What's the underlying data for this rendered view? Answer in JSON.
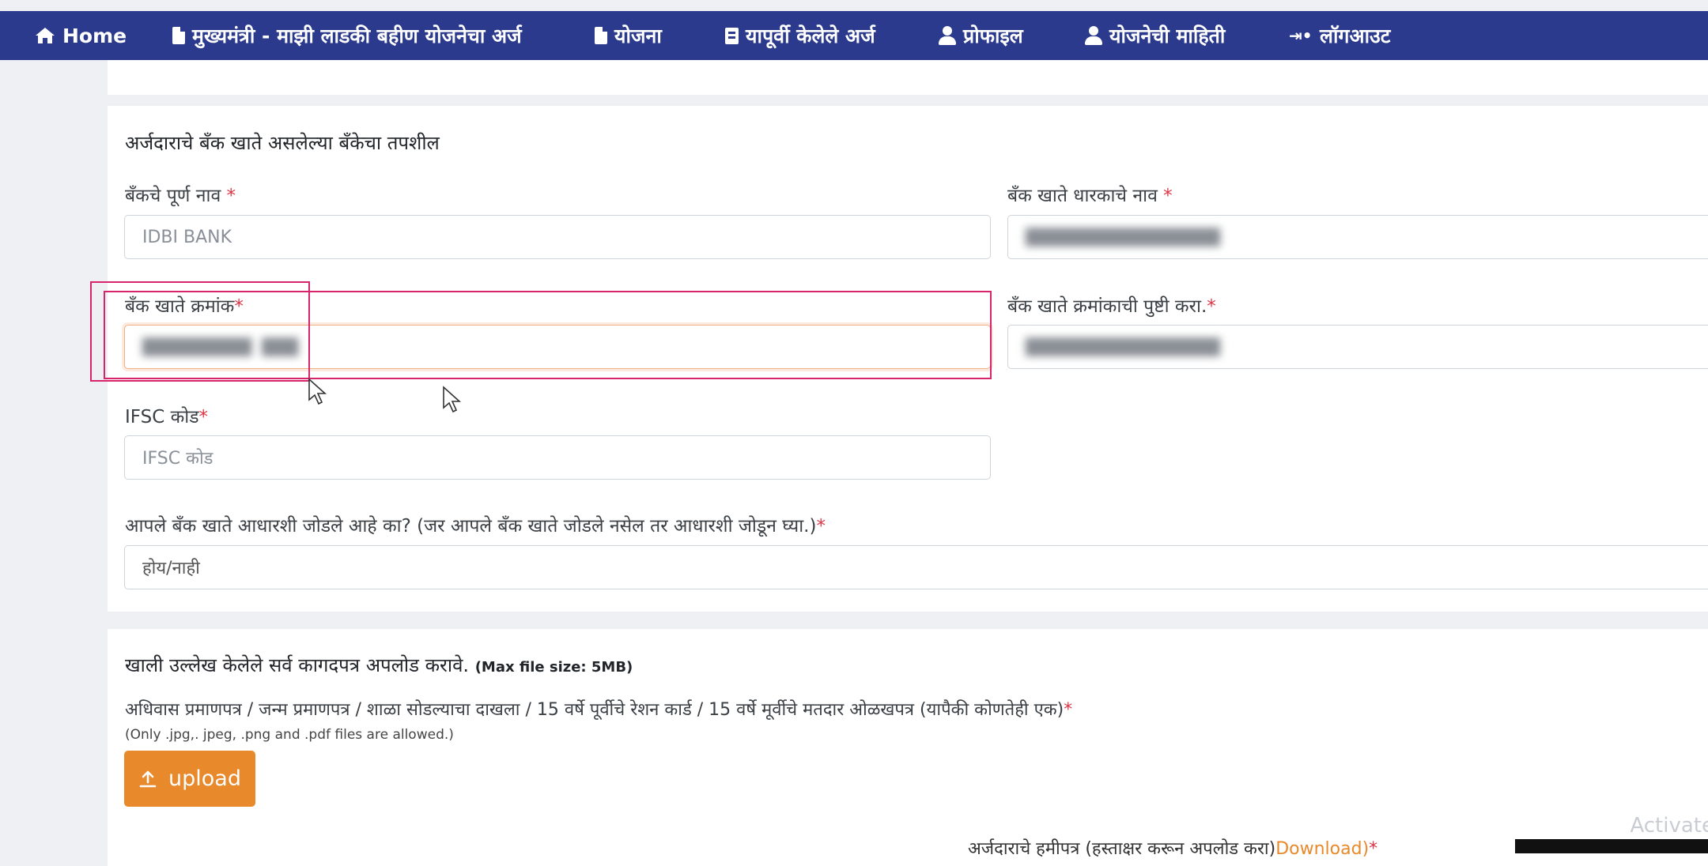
{
  "nav": {
    "home": "Home",
    "application": "मुख्यमंत्री - माझी लाडकी बहीण योजनेचा अर्ज",
    "schemes": "योजना",
    "previous": "यापूर्वी केलेले अर्ज",
    "profile": "प्रोफाइल",
    "scheme_info": "योजनेची माहिती",
    "logout": "लॉगआउट"
  },
  "bank": {
    "section_title": "अर्जदाराचे बँक खाते असलेल्या बँकेचा तपशील",
    "bank_name_label": "बँकचे पूर्ण नाव",
    "bank_name_value": "IDBI BANK",
    "holder_label": "बँक खाते धारकाचे नाव",
    "account_label": "बँक खाते क्रमांक",
    "confirm_label": "बँक खाते क्रमांकाची पुष्टी करा.",
    "ifsc_label": "IFSC कोड",
    "ifsc_placeholder": "IFSC कोड",
    "aadhaar_label": "आपले बँक खाते आधारशी जोडले आहे का? (जर आपले बँक खाते जोडले नसेल तर आधारशी जोडून घ्या.)",
    "aadhaar_value": "होय/नाही",
    "required_mark": "*"
  },
  "docs": {
    "title": "खाली उल्लेख केलेले सर्व कागदपत्र अपलोड करावे.",
    "max_size": "(Max file size: 5MB)",
    "domicile_label": "अधिवास प्रमाणपत्र / जन्म प्रमाणपत्र / शाळा सोडल्याचा दाखला / 15 वर्षे पूर्वीचे रेशन कार्ड / 15 वर्षे मूर्वीचे मतदार ओळखपत्र (यापैकी कोणतेही एक)",
    "file_types": "(Only .jpg,. jpeg, .png and .pdf files are allowed.)",
    "upload_label": "upload",
    "undertaking_label": "अर्जदाराचे हमीपत्र (हस्ताक्षर करून अपलोड करा)",
    "download_label": "Download)",
    "watermark": "Activate"
  },
  "colors": {
    "navbar": "#2b3a8c",
    "required": "#dc3545",
    "upload_button": "#e8892b",
    "annotation": "#d8246b"
  }
}
